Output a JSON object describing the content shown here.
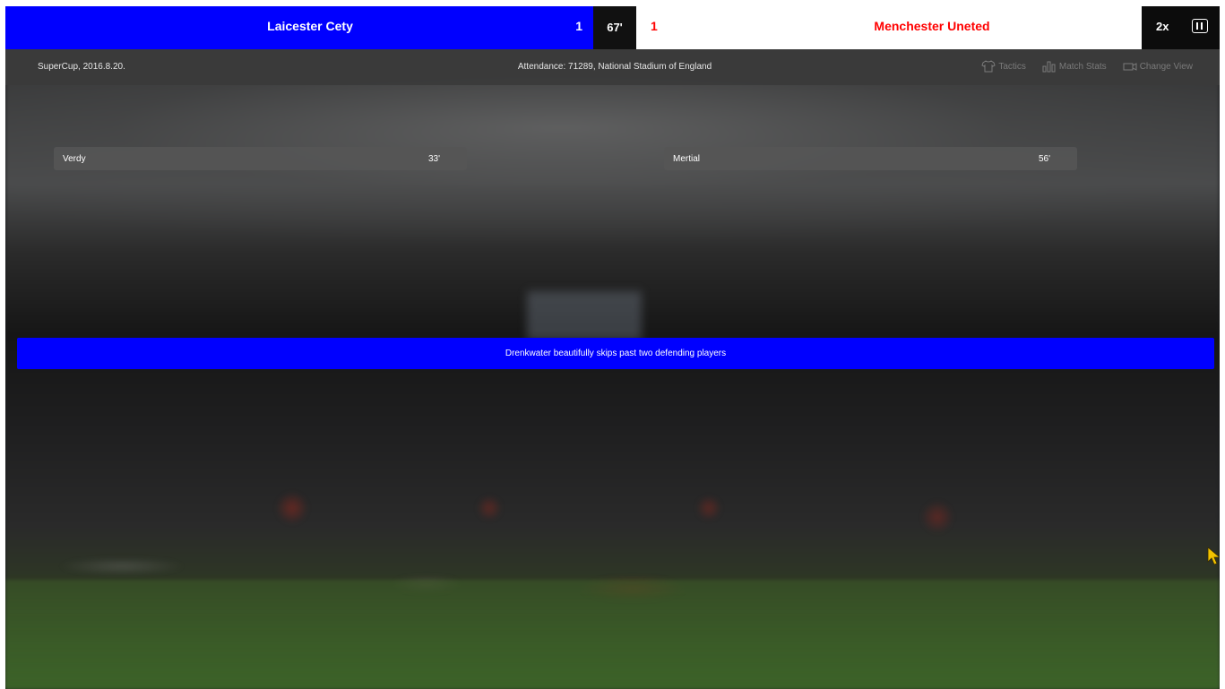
{
  "scoreboard": {
    "home_team": "Laicester Cety",
    "home_score": "1",
    "clock": "67'",
    "away_score": "1",
    "away_team": "Menchester Uneted",
    "speed": "2x",
    "home_color": "#0000ff",
    "away_color": "#ff0000"
  },
  "info": {
    "competition": "SuperCup, 2016.8.20.",
    "attendance": "Attendance: 71289, National Stadium of England"
  },
  "menu": {
    "tactics": "Tactics",
    "match_stats": "Match Stats",
    "change_view": "Change View"
  },
  "scorers": {
    "home": {
      "name": "Verdy",
      "minute": "33'"
    },
    "away": {
      "name": "Mertial",
      "minute": "56'"
    }
  },
  "commentary": "Drenkwater beautifully skips past two defending players",
  "icons": {
    "tactics": "shirt-icon",
    "match_stats": "bar-chart-icon",
    "change_view": "camera-icon",
    "pause": "pause-icon",
    "cursor": "mouse-cursor-icon"
  }
}
